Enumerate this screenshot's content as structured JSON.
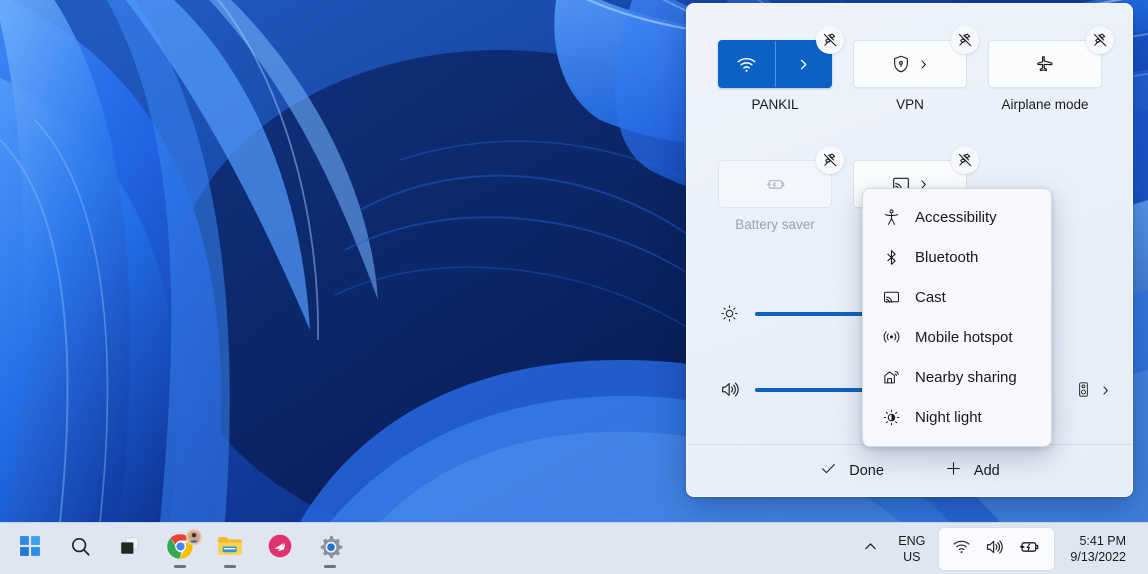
{
  "desktop": {
    "wallpaper_name": "windows-11-bloom-blue",
    "colors": {
      "deep": "#071b4d",
      "mid": "#0d35a4",
      "bright": "#2f7ef5",
      "light": "#55a0ff"
    }
  },
  "quick_settings": {
    "tiles": [
      {
        "id": "wifi",
        "label": "PANKIL",
        "icon": "wifi-icon",
        "state": "on",
        "split": true,
        "chevron": true,
        "unpin": true
      },
      {
        "id": "vpn",
        "label": "VPN",
        "icon": "shield-lock-icon",
        "state": "off",
        "split": false,
        "chevron": true,
        "unpin": true
      },
      {
        "id": "airplane",
        "label": "Airplane mode",
        "icon": "airplane-icon",
        "state": "off",
        "split": false,
        "chevron": false,
        "unpin": true
      },
      {
        "id": "battery-saver",
        "label": "Battery saver",
        "icon": "battery-saver-icon",
        "state": "disabled",
        "split": false,
        "chevron": false,
        "unpin": true
      },
      {
        "id": "cast",
        "label": "",
        "icon": "cast-icon",
        "state": "off",
        "split": false,
        "chevron": true,
        "unpin": true
      }
    ],
    "sliders": [
      {
        "id": "brightness",
        "icon": "brightness-icon",
        "value": 100,
        "fill_percent": 100
      },
      {
        "id": "volume",
        "icon": "volume-icon",
        "value": 78,
        "fill_percent": 78
      }
    ],
    "audio_output": {
      "icon": "speaker-device-icon",
      "chevron": "chevron-right-icon"
    },
    "footer": {
      "done_label": "Done",
      "done_icon": "check-icon",
      "add_label": "Add",
      "add_icon": "plus-icon"
    },
    "accent_color": "#0b62c4",
    "panel_bg": "#eaf0fa"
  },
  "flyout_menu": {
    "items": [
      {
        "label": "Accessibility",
        "icon": "accessibility-icon"
      },
      {
        "label": "Bluetooth",
        "icon": "bluetooth-icon"
      },
      {
        "label": "Cast",
        "icon": "cast-icon"
      },
      {
        "label": "Mobile hotspot",
        "icon": "mobile-hotspot-icon"
      },
      {
        "label": "Nearby sharing",
        "icon": "nearby-sharing-icon"
      },
      {
        "label": "Night light",
        "icon": "night-light-icon"
      }
    ]
  },
  "taskbar": {
    "apps": [
      {
        "id": "start",
        "icon": "windows-start-icon",
        "running": false
      },
      {
        "id": "search",
        "icon": "search-icon",
        "running": false
      },
      {
        "id": "task-view",
        "icon": "task-view-icon",
        "running": false
      },
      {
        "id": "chrome",
        "icon": "chrome-icon",
        "running": true
      },
      {
        "id": "file-explorer",
        "icon": "folder-icon",
        "running": true
      },
      {
        "id": "app-pink",
        "icon": "pink-app-icon",
        "running": false
      },
      {
        "id": "settings",
        "icon": "gear-icon",
        "running": true
      }
    ],
    "tray": {
      "overflow_icon": "chevron-up-icon",
      "language_line1": "ENG",
      "language_line2": "US",
      "status_icons": [
        "wifi-icon",
        "volume-icon",
        "battery-charging-icon"
      ],
      "time": "5:41 PM",
      "date": "9/13/2022"
    }
  }
}
